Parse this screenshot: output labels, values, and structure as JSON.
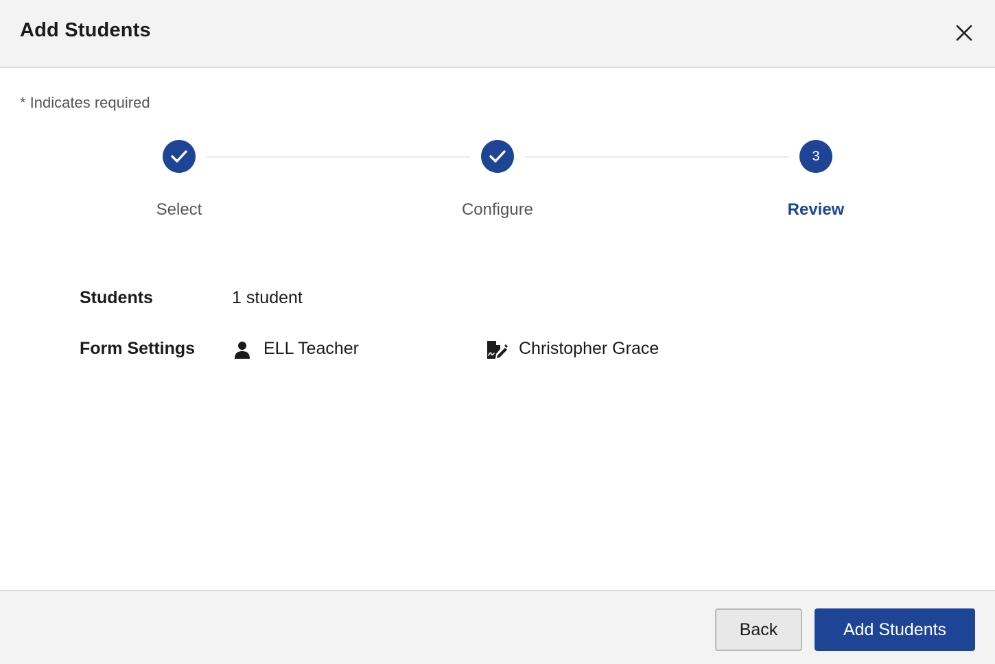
{
  "dialog": {
    "title": "Add Students",
    "close_icon": "close-icon"
  },
  "required_note": "* Indicates required",
  "stepper": {
    "steps": [
      {
        "label": "Select",
        "state": "complete",
        "marker": ""
      },
      {
        "label": "Configure",
        "state": "complete",
        "marker": ""
      },
      {
        "label": "Review",
        "state": "active",
        "marker": "3"
      }
    ],
    "active_color": "#1e4496"
  },
  "review": {
    "students_label": "Students",
    "students_value": "1 student",
    "form_settings_label": "Form Settings",
    "role_icon": "person-icon",
    "role_value": "ELL Teacher",
    "signer_icon": "signature-document-icon",
    "signer_value": "Christopher Grace"
  },
  "footer": {
    "back_label": "Back",
    "submit_label": "Add Students"
  }
}
